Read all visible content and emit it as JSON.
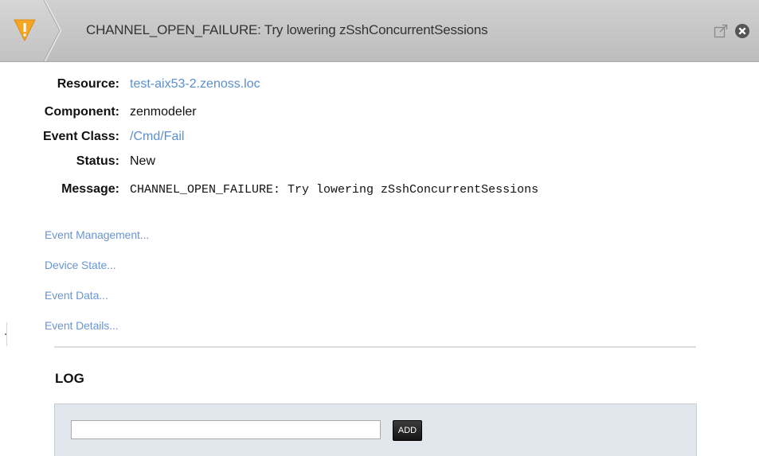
{
  "header": {
    "title": "CHANNEL_OPEN_FAILURE: Try lowering zSshConcurrentSessions",
    "severity_icon": "warning-triangle-icon",
    "severity_color": "#f5a623",
    "actions": {
      "popout_icon": "popout-icon",
      "close_icon": "close-icon"
    }
  },
  "fields": {
    "resource": {
      "label": "Resource:",
      "value": "test-aix53-2.zenoss.loc"
    },
    "component": {
      "label": "Component:",
      "value": "zenmodeler"
    },
    "event_class": {
      "label": "Event Class:",
      "value": "/Cmd/Fail"
    },
    "status": {
      "label": "Status:",
      "value": "New"
    },
    "message": {
      "label": "Message:",
      "value": "CHANNEL_OPEN_FAILURE: Try lowering zSshConcurrentSessions"
    }
  },
  "sections": [
    {
      "label": "Event Management..."
    },
    {
      "label": "Device State..."
    },
    {
      "label": "Event Data..."
    },
    {
      "label": "Event Details..."
    }
  ],
  "log": {
    "title": "LOG",
    "input_value": "",
    "add_label": "ADD"
  },
  "colors": {
    "link": "#5b8fd0",
    "header_bg": "#c6c6c6",
    "log_panel_bg": "#e1e7ec"
  }
}
